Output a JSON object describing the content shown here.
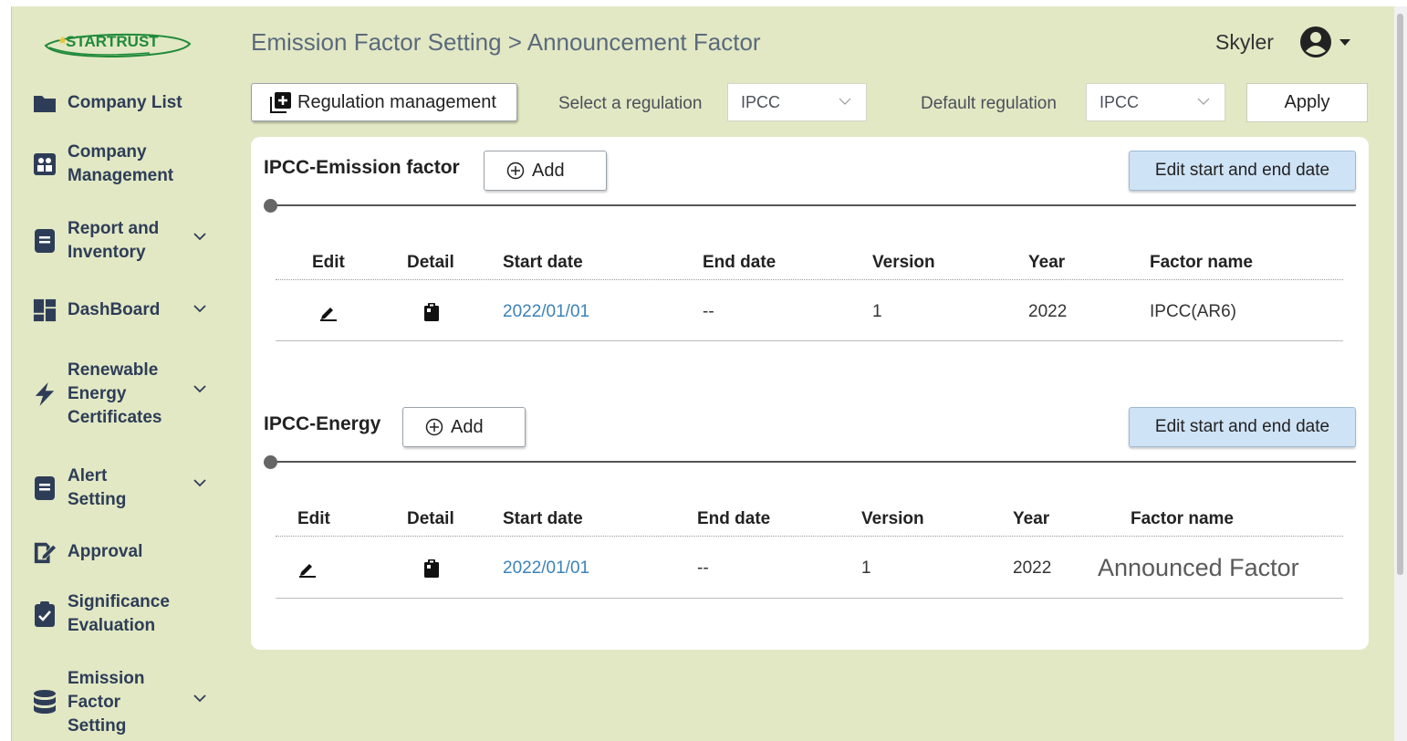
{
  "brand": {
    "logo_text": "STARTRUST"
  },
  "header": {
    "breadcrumb": "Emission Factor Setting > Announcement Factor",
    "user_name": "Skyler"
  },
  "sidebar": {
    "items": [
      {
        "label": "Company List",
        "icon": "folder-icon",
        "has_chevron": false
      },
      {
        "label": "Company Management",
        "icon": "team-board-icon",
        "has_chevron": false
      },
      {
        "label": "Report and Inventory",
        "icon": "document-icon",
        "has_chevron": true
      },
      {
        "label": "DashBoard",
        "icon": "dashboard-icon",
        "has_chevron": true
      },
      {
        "label": "Renewable Energy Certificates",
        "icon": "lightning-icon",
        "has_chevron": true
      },
      {
        "label": "Alert Setting",
        "icon": "document-icon",
        "has_chevron": true
      },
      {
        "label": "Approval",
        "icon": "signature-icon",
        "has_chevron": false
      },
      {
        "label": "Significance Evaluation",
        "icon": "clipboard-check-icon",
        "has_chevron": false
      },
      {
        "label": "Emission Factor Setting",
        "icon": "database-icon",
        "has_chevron": true
      }
    ]
  },
  "toolbar": {
    "regulation_button": "Regulation management",
    "select_label": "Select a regulation",
    "select_value": "IPCC",
    "default_label": "Default regulation",
    "default_value": "IPCC",
    "apply_label": "Apply"
  },
  "sections": [
    {
      "title": "IPCC-Emission factor",
      "add_label": "Add",
      "edit_dates_label": "Edit start and end date",
      "columns": [
        "Edit",
        "Detail",
        "Start date",
        "End date",
        "Version",
        "Year",
        "Factor name"
      ],
      "rows": [
        {
          "start_date": "2022/01/01",
          "end_date": "--",
          "version": "1",
          "year": "2022",
          "factor_name": "IPCC(AR6)"
        }
      ]
    },
    {
      "title": "IPCC-Energy",
      "add_label": "Add",
      "edit_dates_label": "Edit start and end date",
      "columns": [
        "Edit",
        "Detail",
        "Start date",
        "End date",
        "Version",
        "Year",
        "Factor name"
      ],
      "rows": [
        {
          "start_date": "2022/01/01",
          "end_date": "--",
          "version": "1",
          "year": "2022",
          "factor_name": "Announced Factor"
        }
      ]
    }
  ],
  "colors": {
    "background": "#e2e8c4",
    "nav_text": "#2e3d57",
    "link": "#3c82b8",
    "edit_button": "#cfe3f6",
    "logo_green": "#1f8a3a"
  }
}
